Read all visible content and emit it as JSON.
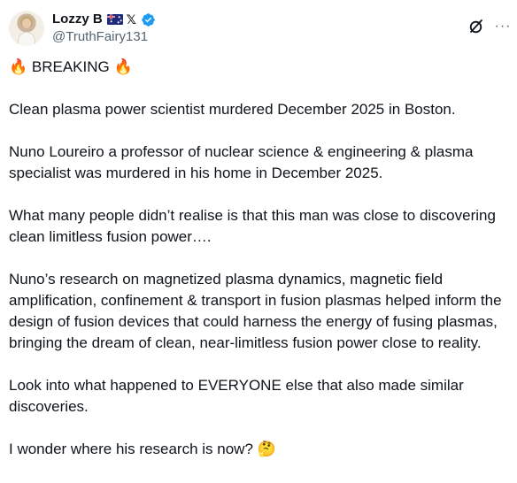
{
  "author": {
    "display_name": "Lozzy B",
    "handle": "@TruthFairy131",
    "badges": [
      "australia-flag-icon",
      "x-logo-icon",
      "verified-badge-icon"
    ],
    "verified_color": "#1d9bf0"
  },
  "actions": {
    "grok_icon": "grok-icon",
    "more_icon": "more-options-icon",
    "more_glyph": "···"
  },
  "post": {
    "paragraphs": [
      "🔥 BREAKING 🔥",
      "Clean plasma power scientist murdered December 2025 in Boston.",
      "Nuno Loureiro a professor of nuclear science & engineering & plasma specialist was murdered in his home in December 2025.",
      "What many people didn’t realise is that this man was close to discovering clean limitless fusion power….",
      "Nuno’s research on magnetized plasma dynamics, magnetic field amplification, confinement & transport in fusion plasmas helped inform the design of fusion devices that could harness the energy of fusing plasmas, bringing the dream of clean, near-limitless fusion power close to reality.",
      "Look into what happened to EVERYONE else that also made similar discoveries.",
      "I wonder where his research is now? 🤔"
    ]
  },
  "colors": {
    "text": "#0f1419",
    "secondary": "#536471",
    "accent": "#1d9bf0"
  }
}
